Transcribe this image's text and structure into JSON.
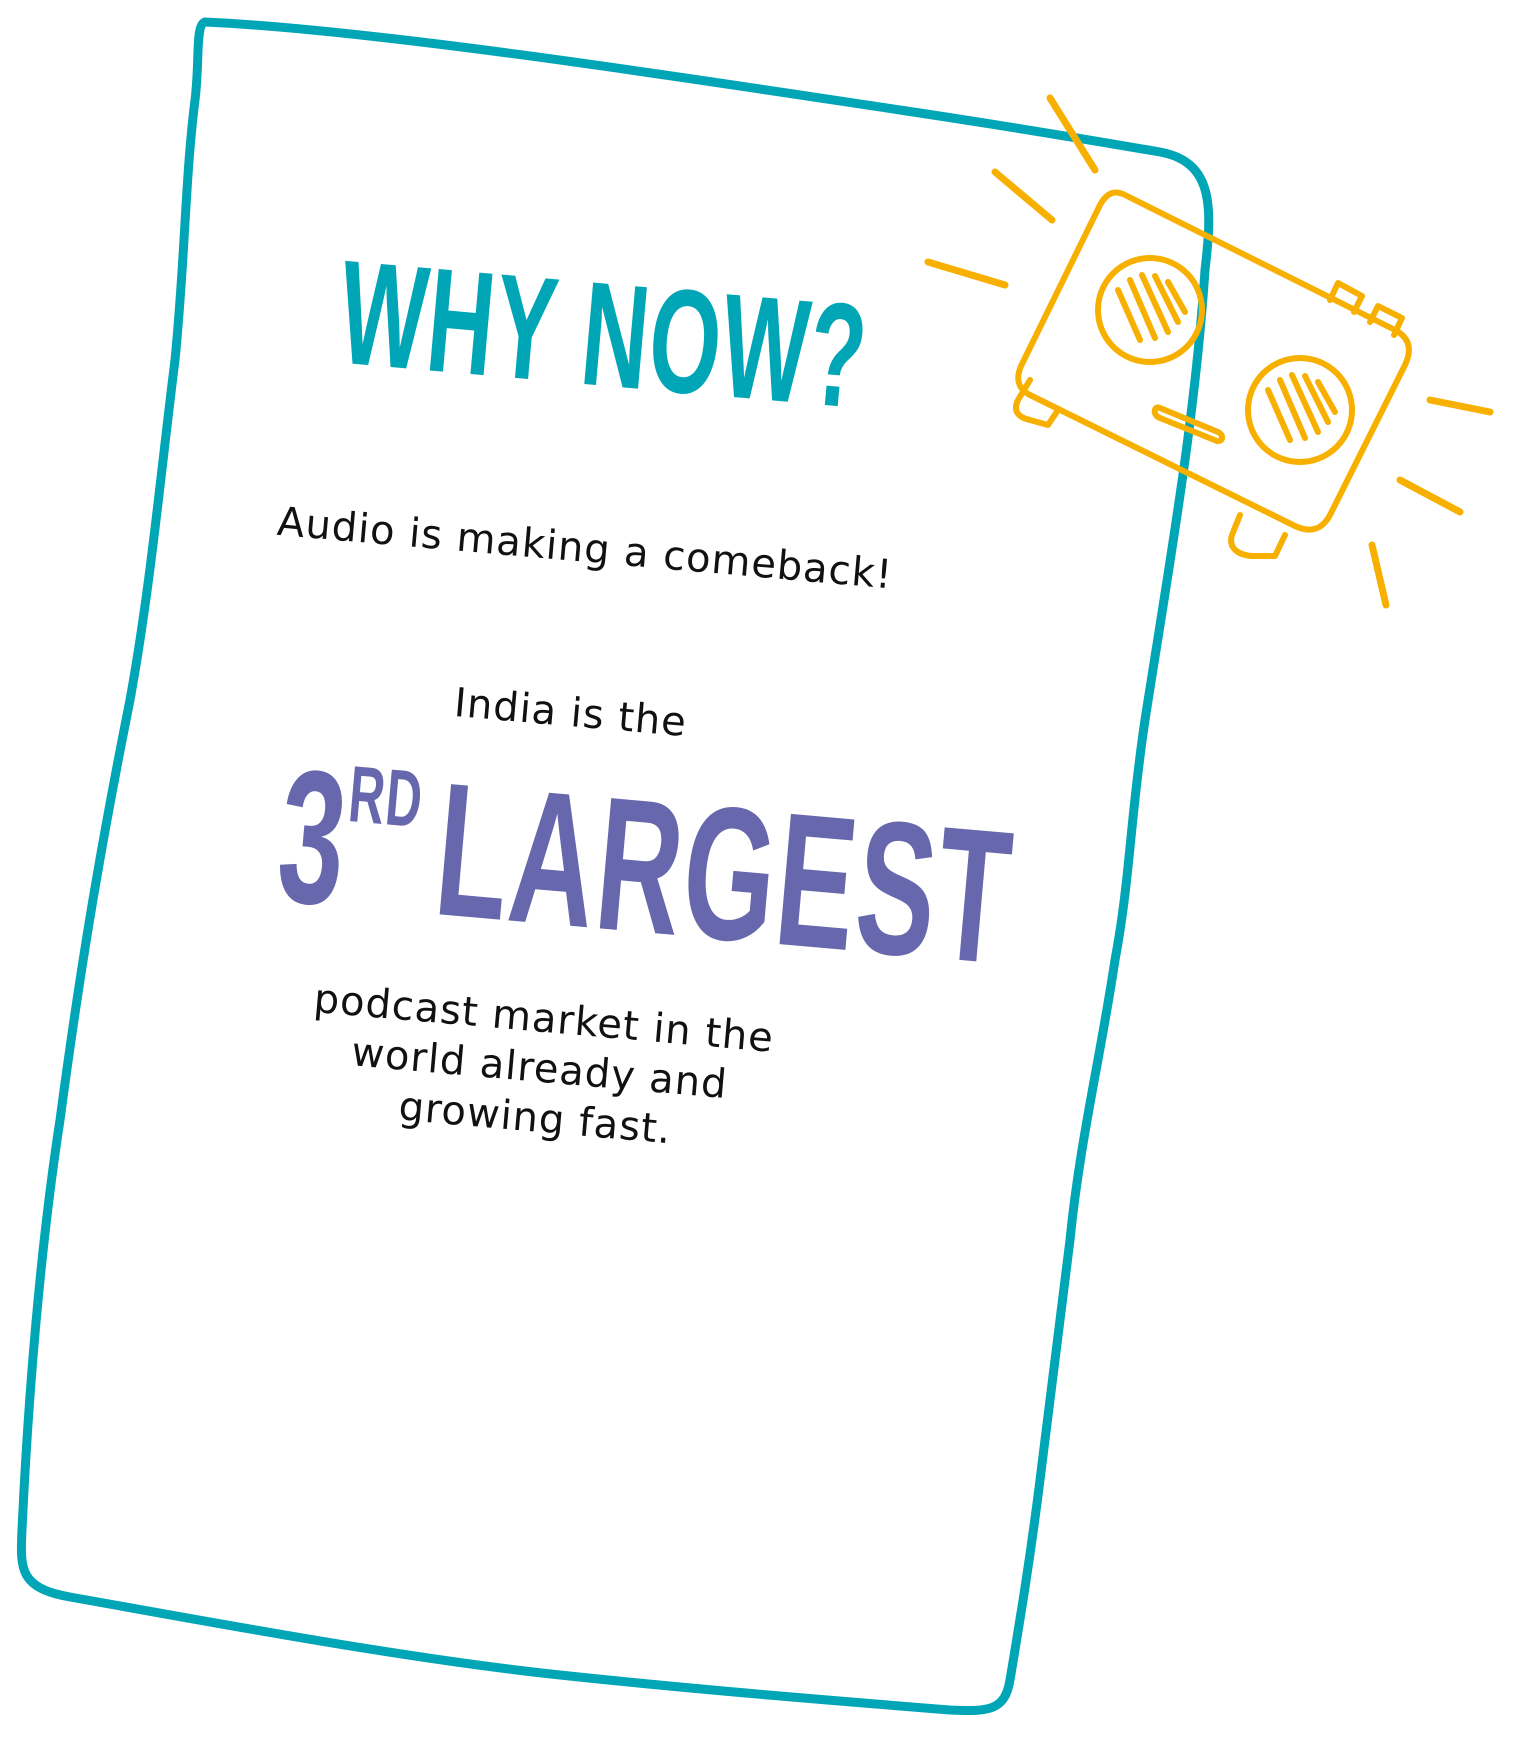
{
  "heading": "WHY NOW?",
  "tagline": "Audio is making a comeback!",
  "intro": "India is the",
  "highlight": {
    "number": "3",
    "suffix": "RD",
    "word": "LARGEST"
  },
  "outro_lines": [
    "podcast market in the",
    "world already and",
    "growing fast."
  ],
  "colors": {
    "frame": "#00a6b6",
    "heading": "#00a6b6",
    "highlight": "#6767ad",
    "doodle": "#f8b000",
    "text": "#111111"
  },
  "icons": [
    "boombox-doodle-icon"
  ]
}
